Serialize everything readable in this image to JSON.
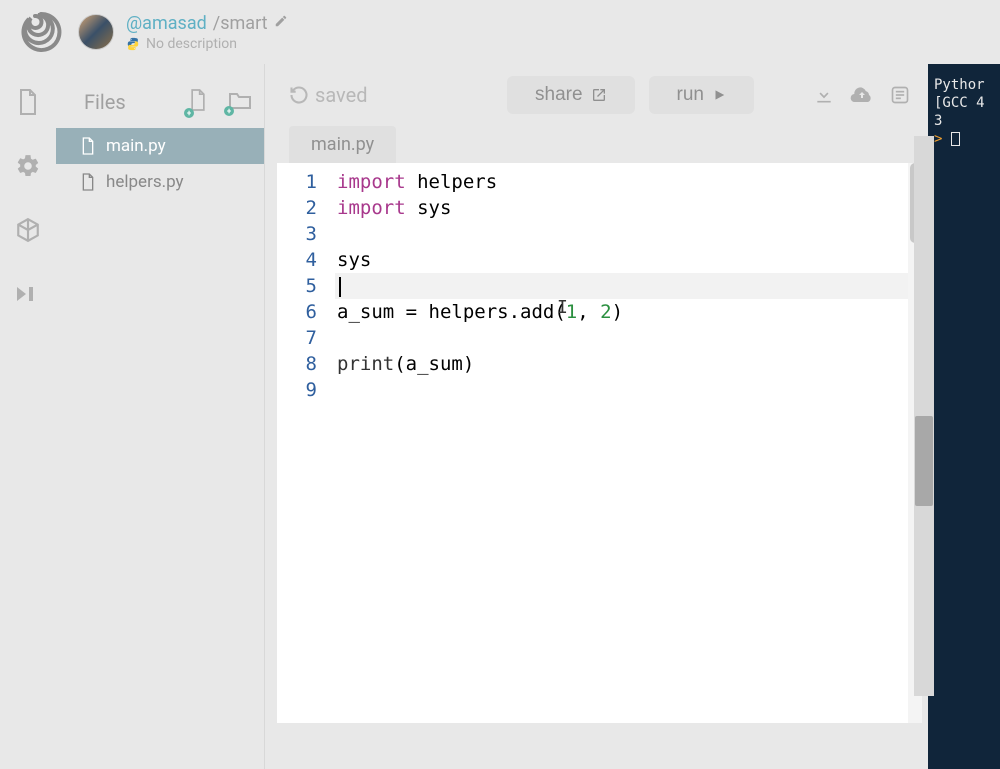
{
  "header": {
    "username": "@amasad",
    "separator": "/",
    "project_name": "smart",
    "description": "No description",
    "language": "python"
  },
  "sidebar": {
    "files_label": "Files",
    "items": [
      {
        "name": "main.py",
        "active": true
      },
      {
        "name": "helpers.py",
        "active": false
      }
    ]
  },
  "toolbar": {
    "saved_label": "saved",
    "share_label": "share",
    "run_label": "run"
  },
  "editor": {
    "active_tab": "main.py",
    "current_line": 5,
    "line_numbers": [
      "1",
      "2",
      "3",
      "4",
      "5",
      "6",
      "7",
      "8",
      "9"
    ],
    "lines": {
      "l1_kw": "import",
      "l1_rest": " helpers",
      "l2_kw": "import",
      "l2_rest": " sys",
      "l3": "",
      "l4": "sys",
      "l5": "",
      "l6_a": "a_sum = helpers.add(",
      "l6_n1": "1",
      "l6_mid": ", ",
      "l6_n2": "2",
      "l6_z": ")",
      "l7": "",
      "l8_fn": "print",
      "l8_a": "(a_sum)",
      "l9": ""
    }
  },
  "console": {
    "line1": "Pythor",
    "line2": "[GCC 4",
    "line3": "3",
    "prompt": ">"
  }
}
